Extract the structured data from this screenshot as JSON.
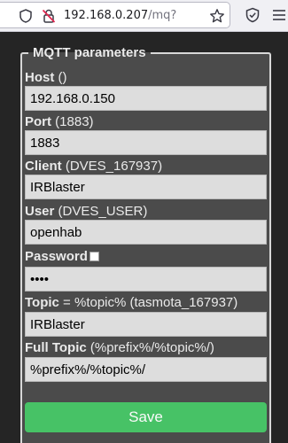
{
  "browser": {
    "url_host": "192.168.0.207",
    "url_path": "/mq?"
  },
  "mqtt": {
    "legend": "MQTT parameters",
    "host": {
      "label": "Host",
      "hint": " ()",
      "value": "192.168.0.150"
    },
    "port": {
      "label": "Port",
      "hint": " (1883)",
      "value": "1883"
    },
    "client": {
      "label": "Client",
      "hint": " (DVES_167937)",
      "value": "IRBlaster"
    },
    "user": {
      "label": "User",
      "hint": " (DVES_USER)",
      "value": "openhab"
    },
    "password": {
      "label": "Password",
      "value": "••••"
    },
    "topic": {
      "label": "Topic",
      "hint": " = %topic% (tasmota_167937)",
      "value": "IRBlaster"
    },
    "full_topic": {
      "label": "Full Topic",
      "hint": " (%prefix%/%topic%/)",
      "value": "%prefix%/%topic%/"
    },
    "save_label": "Save"
  },
  "colors": {
    "page_bg": "#252525",
    "fieldset_bg": "#4b4b4b",
    "input_bg": "#dddddd",
    "save_button": "#47c266"
  },
  "icons": [
    "shield-icon",
    "lock-icon",
    "star-icon",
    "shield-check-icon",
    "menu-icon"
  ]
}
